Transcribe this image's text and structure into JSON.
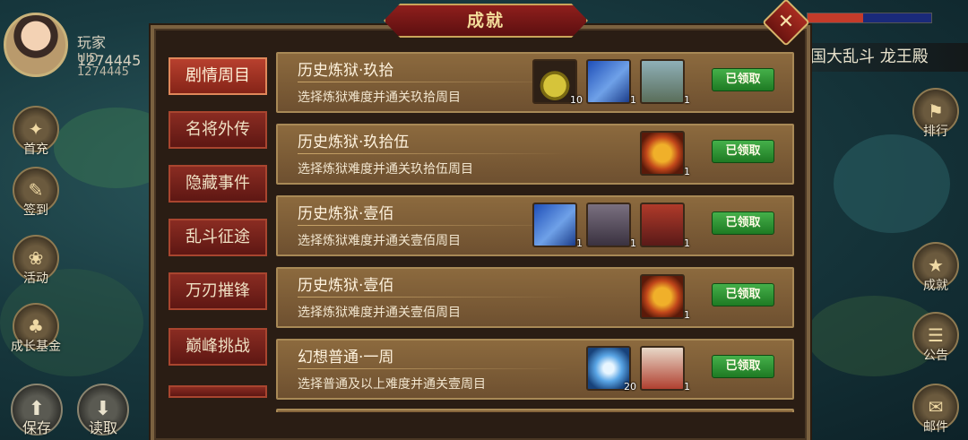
{
  "player": {
    "name": "玩家1274445",
    "uid": "UID  1274445"
  },
  "location": "国大乱斗 龙王殿",
  "left_menu": [
    {
      "label": "首充",
      "icon": "first-charge-icon"
    },
    {
      "label": "签到",
      "icon": "sign-in-icon"
    },
    {
      "label": "活动",
      "icon": "activity-icon"
    },
    {
      "label": "成长基金",
      "icon": "growth-fund-icon"
    }
  ],
  "right_menu": [
    {
      "label": "排行",
      "icon": "ranking-icon"
    },
    {
      "label": "成就",
      "icon": "achievement-icon"
    },
    {
      "label": "公告",
      "icon": "notice-icon"
    },
    {
      "label": "邮件",
      "icon": "mail-icon"
    }
  ],
  "bottom_menu": [
    {
      "label": "保存",
      "icon": "save-icon"
    },
    {
      "label": "读取",
      "icon": "load-icon"
    }
  ],
  "dialog": {
    "title": "成就",
    "close_glyph": "✕",
    "tabs": [
      {
        "label": "剧情周目",
        "active": true
      },
      {
        "label": "名将外传",
        "active": false
      },
      {
        "label": "隐藏事件",
        "active": false
      },
      {
        "label": "乱斗征途",
        "active": false
      },
      {
        "label": "万刃摧锋",
        "active": false
      },
      {
        "label": "巅峰挑战",
        "active": false
      }
    ],
    "achievements": [
      {
        "title": "历史炼狱·玖拾",
        "desc": "选择炼狱难度并通关玖拾周目",
        "status": "已领取",
        "rewards": [
          {
            "icon": "golden-fruit-icon",
            "count": "10"
          },
          {
            "icon": "scroll-icon",
            "count": "1"
          },
          {
            "icon": "hero-portrait-icon",
            "count": "1"
          }
        ]
      },
      {
        "title": "历史炼狱·玖拾伍",
        "desc": "选择炼狱难度并通关玖拾伍周目",
        "status": "已领取",
        "rewards": [
          {
            "icon": "treasure-chest-icon",
            "count": "1"
          }
        ]
      },
      {
        "title": "历史炼狱·壹佰",
        "desc": "选择炼狱难度并通关壹佰周目",
        "status": "已领取",
        "rewards": [
          {
            "icon": "scroll-icon",
            "count": "1"
          },
          {
            "icon": "hero-portrait-icon",
            "count": "1"
          },
          {
            "icon": "hero-portrait-icon",
            "count": "1"
          }
        ]
      },
      {
        "title": "历史炼狱·壹佰",
        "desc": "选择炼狱难度并通关壹佰周目",
        "status": "已领取",
        "rewards": [
          {
            "icon": "treasure-chest-icon",
            "count": "1"
          }
        ]
      },
      {
        "title": "幻想普通·一周",
        "desc": "选择普通及以上难度并通关壹周目",
        "status": "已领取",
        "rewards": [
          {
            "icon": "crystal-icon",
            "count": "20"
          },
          {
            "icon": "hero-portrait-icon",
            "count": "1"
          }
        ]
      }
    ]
  }
}
